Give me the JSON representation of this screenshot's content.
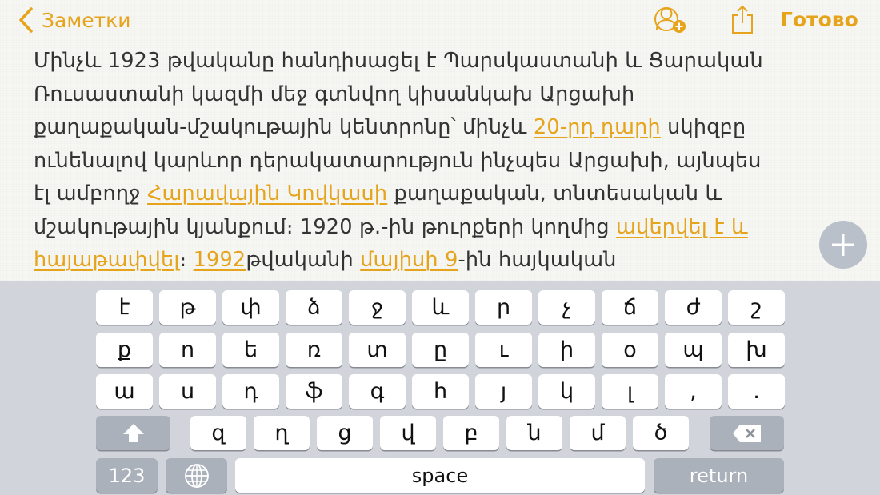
{
  "nav": {
    "back_label": "Заметки",
    "done_label": "Готово"
  },
  "colors": {
    "accent": "#e6a41c",
    "keyboard_bg": "#d1d5db",
    "key_bg": "#ffffff",
    "dark_key_bg": "#abb1bb",
    "text": "#333333"
  },
  "icons": [
    "chevron-left-icon",
    "add-person-icon",
    "share-icon",
    "plus-icon",
    "shift-icon",
    "delete-icon",
    "globe-icon"
  ],
  "note": {
    "lines": [
      [
        {
          "t": "Մինչև 1923 թվականը հանդիսացել է Պարսկաստանի և Ցարական"
        }
      ],
      [
        {
          "t": "Ռուսաստանի կազմի մեջ գտնվող կիսանկախ Արցախի"
        }
      ],
      [
        {
          "t": "քաղաքական-մշակութային կենտրոնը՝ մինչև "
        },
        {
          "t": "20-րդ դարի",
          "link": true
        },
        {
          "t": " սկիզբը"
        }
      ],
      [
        {
          "t": "ունենալով կարևոր դերակատարություն ինչպես Արցախի, այնպես"
        }
      ],
      [
        {
          "t": "էլ ամբողջ "
        },
        {
          "t": "Հարավային Կովկասի",
          "link": true
        },
        {
          "t": " քաղաքական, տնտեսական և"
        }
      ],
      [
        {
          "t": "մշակութային կյանքում։ 1920 թ.-ին թուրքերի կողմից "
        },
        {
          "t": "ավերվել է և",
          "link": true
        }
      ],
      [
        {
          "t": "հայաթափվել",
          "link": true
        },
        {
          "t": "։ "
        },
        {
          "t": "1992",
          "link": true
        },
        {
          "t": "թվականի "
        },
        {
          "t": "մայիսի 9",
          "link": true
        },
        {
          "t": "-ին հայկական"
        }
      ]
    ]
  },
  "keyboard": {
    "row1": [
      "է",
      "թ",
      "փ",
      "ձ",
      "ջ",
      "և",
      "ր",
      "չ",
      "ճ",
      "ժ",
      "շ"
    ],
    "row2": [
      "ք",
      "ո",
      "ե",
      "ռ",
      "տ",
      "ը",
      "ւ",
      "ի",
      "օ",
      "պ",
      "խ"
    ],
    "row3": [
      "ա",
      "ս",
      "դ",
      "ֆ",
      "գ",
      "հ",
      "յ",
      "կ",
      "լ",
      ",",
      "."
    ],
    "row4": [
      "զ",
      "ղ",
      "ց",
      "վ",
      "բ",
      "ն",
      "մ",
      "ծ"
    ],
    "numbers_label": "123",
    "space_label": "space",
    "return_label": "return"
  }
}
